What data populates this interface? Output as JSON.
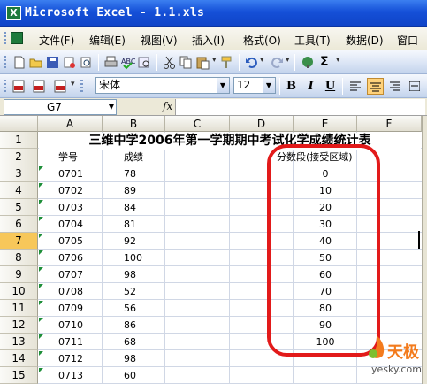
{
  "window": {
    "title": "Microsoft Excel - 1.1.xls",
    "app_icon": "excel-icon"
  },
  "menu": {
    "items": [
      {
        "label": "文件(F)"
      },
      {
        "label": "编辑(E)"
      },
      {
        "label": "视图(V)"
      },
      {
        "label": "插入(I)"
      },
      {
        "label": "格式(O)"
      },
      {
        "label": "工具(T)"
      },
      {
        "label": "数据(D)"
      },
      {
        "label": "窗口"
      }
    ]
  },
  "toolbar": {
    "standard_icons": [
      "new-icon",
      "open-icon",
      "save-icon",
      "permission-icon",
      "print-preview-icon",
      "print-icon",
      "spelling-icon",
      "research-icon",
      "cut-icon",
      "copy-icon",
      "paste-icon",
      "format-painter-icon",
      "undo-icon",
      "redo-icon",
      "hyperlink-icon",
      "autosum-icon"
    ],
    "font_name": "宋体",
    "font_size": "12",
    "bold": "B",
    "italic": "I",
    "underline": "U"
  },
  "formula_bar": {
    "name_box": "G7",
    "fx": "fx",
    "formula": ""
  },
  "sheet": {
    "columns": [
      "A",
      "B",
      "C",
      "D",
      "E",
      "F"
    ],
    "rows": [
      "1",
      "2",
      "3",
      "4",
      "5",
      "6",
      "7",
      "8",
      "9",
      "10",
      "11",
      "12",
      "13",
      "14",
      "15"
    ],
    "selected_row": "7",
    "title": "三维中学2006年第一学期期中考试化学成绩统计表",
    "headers": {
      "a": "学号",
      "b": "成绩",
      "e": "分数段(接受区域)"
    },
    "data": [
      {
        "id": "0701",
        "score": "78",
        "seg": "0"
      },
      {
        "id": "0702",
        "score": "89",
        "seg": "10"
      },
      {
        "id": "0703",
        "score": "84",
        "seg": "20"
      },
      {
        "id": "0704",
        "score": "81",
        "seg": "30"
      },
      {
        "id": "0705",
        "score": "92",
        "seg": "40"
      },
      {
        "id": "0706",
        "score": "100",
        "seg": "50"
      },
      {
        "id": "0707",
        "score": "98",
        "seg": "60"
      },
      {
        "id": "0708",
        "score": "52",
        "seg": "70"
      },
      {
        "id": "0709",
        "score": "56",
        "seg": "80"
      },
      {
        "id": "0710",
        "score": "86",
        "seg": "90"
      },
      {
        "id": "0711",
        "score": "68",
        "seg": "100"
      },
      {
        "id": "0712",
        "score": "98",
        "seg": ""
      },
      {
        "id": "0713",
        "score": "60",
        "seg": ""
      }
    ]
  },
  "watermark": {
    "brand": "天极",
    "site": "yesky.com"
  },
  "colors": {
    "title_bar": "#1550d8",
    "highlight_oval": "#e21a1a",
    "selected_row_header": "#f7c75a",
    "text_marker": "#1f8f3a"
  }
}
